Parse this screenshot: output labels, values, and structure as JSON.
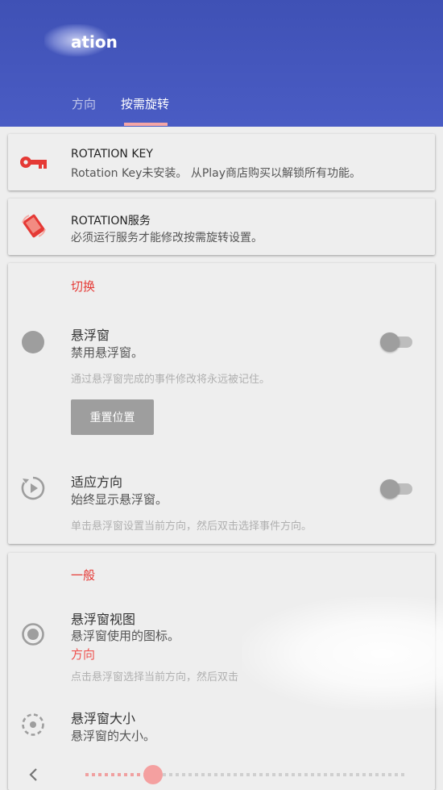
{
  "appbar": {
    "title": "ation",
    "tabs": [
      {
        "label": "方向"
      },
      {
        "label": "按需旋转"
      }
    ]
  },
  "rotation_key": {
    "title": "ROTATION KEY",
    "subtitle": "Rotation Key未安装。 从Play商店购买以解锁所有功能。"
  },
  "rotation_service": {
    "title": "ROTATION服务",
    "subtitle": "必须运行服务才能修改按需旋转设置。"
  },
  "toggle_section": {
    "header": "切换",
    "floating_window": {
      "title": "悬浮窗",
      "subtitle": "禁用悬浮窗。",
      "hint": "通过悬浮窗完成的事件修改将永远被记住。",
      "reset_label": "重置位置"
    },
    "adapt_orientation": {
      "title": "适应方向",
      "subtitle": "始终显示悬浮窗。",
      "hint": "单击悬浮窗设置当前方向，然后双击选择事件方向。"
    }
  },
  "general_section": {
    "header": "一般",
    "floating_view": {
      "title": "悬浮窗视图",
      "subtitle": "悬浮窗使用的图标。",
      "value": "方向",
      "hint": "点击悬浮窗选择当前方向，然后双击"
    },
    "floating_size": {
      "title": "悬浮窗大小",
      "subtitle": "悬浮窗的大小。",
      "slider_fraction": 0.21
    }
  },
  "colors": {
    "primary": "#3f51b5",
    "accent": "#e53935",
    "indicator": "#f5a6a6"
  }
}
